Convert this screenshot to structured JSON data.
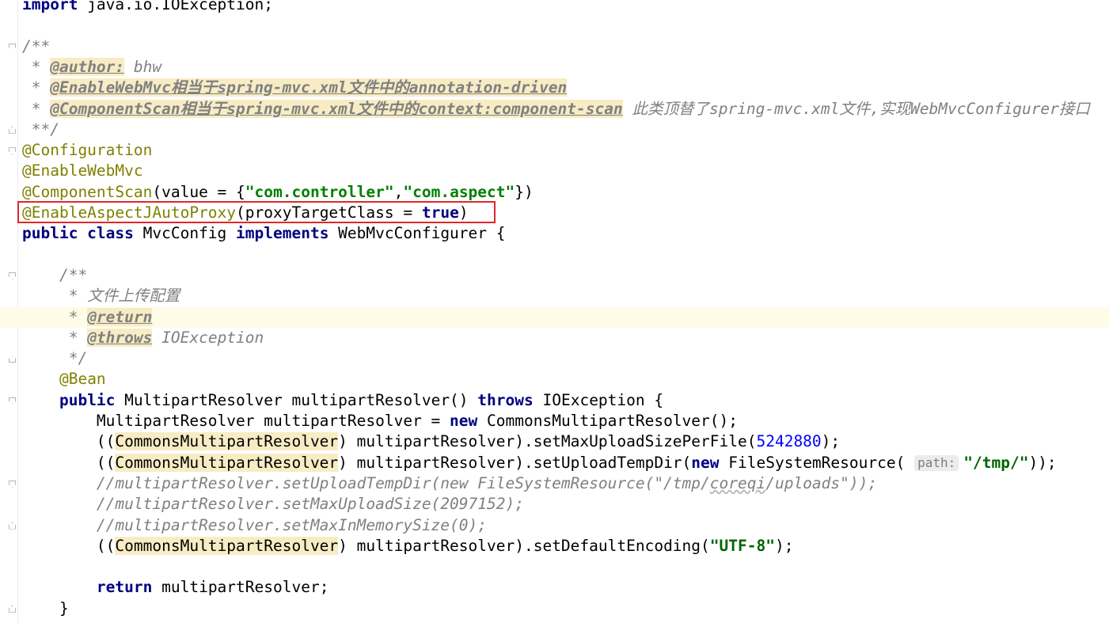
{
  "editor": {
    "lines": [
      {
        "indent": "",
        "tokens": [
          {
            "t": "kw",
            "v": "import"
          },
          {
            "t": "",
            "v": " java.io.IOException;"
          }
        ]
      },
      {
        "indent": "",
        "tokens": []
      },
      {
        "indent": "",
        "fold": "start",
        "tokens": [
          {
            "t": "cmt",
            "v": "/**"
          }
        ]
      },
      {
        "indent": "",
        "tokens": [
          {
            "t": "cmt",
            "v": " * "
          },
          {
            "t": "doctag",
            "v": "@author:"
          },
          {
            "t": "cmt",
            "v": " bhw"
          }
        ]
      },
      {
        "indent": "",
        "tokens": [
          {
            "t": "cmt",
            "v": " * "
          },
          {
            "t": "doctag",
            "v": "@EnableWebMvc相当于spring-mvc.xml文件中的annotation-driven"
          }
        ]
      },
      {
        "indent": "",
        "tokens": [
          {
            "t": "cmt",
            "v": " * "
          },
          {
            "t": "doctag",
            "v": "@ComponentScan相当于spring-mvc.xml文件中的context:component-scan"
          },
          {
            "t": "cmt",
            "v": " 此类顶替了spring-mvc.xml文件,实现WebMvcConfigurer接口"
          }
        ]
      },
      {
        "indent": "",
        "fold": "end",
        "tokens": [
          {
            "t": "cmt",
            "v": " **/"
          }
        ]
      },
      {
        "indent": "",
        "fold": "start",
        "tokens": [
          {
            "t": "ann",
            "v": "@Configuration"
          }
        ]
      },
      {
        "indent": "",
        "tokens": [
          {
            "t": "ann",
            "v": "@EnableWebMvc"
          }
        ]
      },
      {
        "indent": "",
        "tokens": [
          {
            "t": "ann",
            "v": "@ComponentScan"
          },
          {
            "t": "",
            "v": "(value = {"
          },
          {
            "t": "str",
            "v": "\"com.controller\""
          },
          {
            "t": "",
            "v": ","
          },
          {
            "t": "str",
            "v": "\"com.aspect\""
          },
          {
            "t": "",
            "v": "})"
          }
        ]
      },
      {
        "indent": "",
        "tokens": [
          {
            "t": "ann",
            "v": "@EnableAspectJAutoProxy"
          },
          {
            "t": "",
            "v": "(proxyTargetClass = "
          },
          {
            "t": "kw",
            "v": "true"
          },
          {
            "t": "",
            "v": ")"
          }
        ]
      },
      {
        "indent": "",
        "tokens": [
          {
            "t": "kw",
            "v": "public class"
          },
          {
            "t": "",
            "v": " MvcConfig "
          },
          {
            "t": "kw",
            "v": "implements"
          },
          {
            "t": "",
            "v": " WebMvcConfigurer {"
          }
        ]
      },
      {
        "indent": "",
        "tokens": []
      },
      {
        "indent": "    ",
        "fold": "start",
        "tokens": [
          {
            "t": "cmt",
            "v": "/**"
          }
        ]
      },
      {
        "indent": "    ",
        "tokens": [
          {
            "t": "cmt",
            "v": " * 文件上传配置"
          }
        ]
      },
      {
        "indent": "    ",
        "current": true,
        "tokens": [
          {
            "t": "cmt",
            "v": " * "
          },
          {
            "t": "doctag",
            "v": "@return"
          }
        ]
      },
      {
        "indent": "    ",
        "tokens": [
          {
            "t": "cmt",
            "v": " * "
          },
          {
            "t": "doctag",
            "v": "@throws"
          },
          {
            "t": "cmt",
            "v": " IOException"
          }
        ]
      },
      {
        "indent": "    ",
        "fold": "end",
        "tokens": [
          {
            "t": "cmt",
            "v": " */"
          }
        ]
      },
      {
        "indent": "    ",
        "tokens": [
          {
            "t": "ann",
            "v": "@Bean"
          }
        ]
      },
      {
        "indent": "    ",
        "fold": "start",
        "tokens": [
          {
            "t": "kw",
            "v": "public"
          },
          {
            "t": "",
            "v": " MultipartResolver multipartResolver() "
          },
          {
            "t": "kw",
            "v": "throws"
          },
          {
            "t": "",
            "v": " IOException {"
          }
        ]
      },
      {
        "indent": "        ",
        "tokens": [
          {
            "t": "",
            "v": "MultipartResolver multipartResolver = "
          },
          {
            "t": "kw",
            "v": "new"
          },
          {
            "t": "",
            "v": " CommonsMultipartResolver();"
          }
        ]
      },
      {
        "indent": "        ",
        "tokens": [
          {
            "t": "",
            "v": "(("
          },
          {
            "t": "hl",
            "v": "CommonsMultipartResolver"
          },
          {
            "t": "",
            "v": ") multipartResolver).setMaxUploadSizePerFile("
          },
          {
            "t": "num",
            "v": "5242880"
          },
          {
            "t": "",
            "v": ");"
          }
        ]
      },
      {
        "indent": "        ",
        "tokens": [
          {
            "t": "",
            "v": "(("
          },
          {
            "t": "hl",
            "v": "CommonsMultipartResolver"
          },
          {
            "t": "",
            "v": ") multipartResolver).setUploadTempDir("
          },
          {
            "t": "kw",
            "v": "new"
          },
          {
            "t": "",
            "v": " FileSystemResource( "
          },
          {
            "t": "hint",
            "v": "path:"
          },
          {
            "t": "str-dark",
            "v": "\"/tmp/\""
          },
          {
            "t": "",
            "v": "));"
          }
        ]
      },
      {
        "indent": "        ",
        "fold": "start",
        "tokens": [
          {
            "t": "cmt",
            "v": "//multipartResolver.setUploadTempDir(new FileSystemResource(\"/tmp/"
          },
          {
            "t": "cmt-sq",
            "v": "coreqi"
          },
          {
            "t": "cmt",
            "v": "/uploads\"));"
          }
        ]
      },
      {
        "indent": "        ",
        "tokens": [
          {
            "t": "cmt",
            "v": "//multipartResolver.setMaxUploadSize(2097152);"
          }
        ]
      },
      {
        "indent": "        ",
        "fold": "end",
        "tokens": [
          {
            "t": "cmt",
            "v": "//multipartResolver.setMaxInMemorySize(0);"
          }
        ]
      },
      {
        "indent": "        ",
        "tokens": [
          {
            "t": "",
            "v": "(("
          },
          {
            "t": "hl",
            "v": "CommonsMultipartResolver"
          },
          {
            "t": "",
            "v": ") multipartResolver).setDefaultEncoding("
          },
          {
            "t": "str-dark",
            "v": "\"UTF-8\""
          },
          {
            "t": "",
            "v": ");"
          }
        ]
      },
      {
        "indent": "",
        "tokens": []
      },
      {
        "indent": "        ",
        "tokens": [
          {
            "t": "kw",
            "v": "return"
          },
          {
            "t": "",
            "v": " multipartResolver;"
          }
        ]
      },
      {
        "indent": "    ",
        "fold": "end",
        "tokens": [
          {
            "t": "",
            "v": "}"
          }
        ]
      }
    ]
  }
}
